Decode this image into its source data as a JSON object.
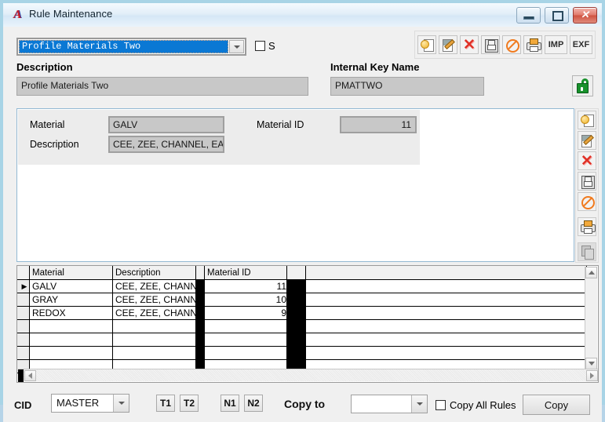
{
  "window": {
    "title": "Rule Maintenance",
    "app_icon": "star-logo-icon",
    "minimize_label": "",
    "maximize_label": "",
    "close_label": "✕"
  },
  "rule_selector": {
    "value": "Profile Materials Two",
    "s_checkbox_label": "S",
    "s_checked": false
  },
  "top_toolbar": {
    "buttons": [
      {
        "name": "new",
        "icon": "new-page-icon",
        "label": ""
      },
      {
        "name": "edit",
        "icon": "edit-pencil-icon",
        "label": ""
      },
      {
        "name": "delete",
        "icon": "delete-x-icon",
        "label": ""
      },
      {
        "name": "save",
        "icon": "save-disk-icon",
        "label": ""
      },
      {
        "name": "cancel",
        "icon": "cancel-ban-icon",
        "label": ""
      },
      {
        "name": "print",
        "icon": "print-icon",
        "label": ""
      },
      {
        "name": "import",
        "icon": "text-icon",
        "label": "IMP"
      },
      {
        "name": "export",
        "icon": "text-icon",
        "label": "EXF"
      }
    ]
  },
  "header_fields": {
    "description_label": "Description",
    "description_value": "Profile Materials Two",
    "internal_key_label": "Internal Key Name",
    "internal_key_value": "PMATTWO",
    "lock_icon": "unlocked-padlock-icon"
  },
  "detail_panel": {
    "material_label": "Material",
    "material_value": "GALV",
    "description_label": "Description",
    "description_value": "CEE, ZEE, CHANNEL, EAʼ",
    "material_id_label": "Material ID",
    "material_id_value": "11"
  },
  "side_toolbar": {
    "buttons": [
      {
        "name": "new",
        "icon": "new-page-icon",
        "disabled": false
      },
      {
        "name": "edit",
        "icon": "edit-pencil-icon",
        "disabled": false
      },
      {
        "name": "delete",
        "icon": "delete-x-icon",
        "disabled": false
      },
      {
        "name": "save",
        "icon": "save-disk-icon",
        "disabled": false
      },
      {
        "name": "cancel",
        "icon": "cancel-ban-icon",
        "disabled": false
      },
      {
        "name": "print",
        "icon": "print-icon",
        "disabled": false
      },
      {
        "name": "copy",
        "icon": "copy-icon",
        "disabled": true
      }
    ]
  },
  "grid": {
    "columns": [
      "Material",
      "Description",
      "Material ID"
    ],
    "rows": [
      {
        "selected": true,
        "material": "GALV",
        "description": "CEE, ZEE, CHANNEL",
        "material_id": "11"
      },
      {
        "selected": false,
        "material": "GRAY",
        "description": "CEE, ZEE, CHANNEL",
        "material_id": "10"
      },
      {
        "selected": false,
        "material": "REDOX",
        "description": "CEE, ZEE, CHANNEL",
        "material_id": "9"
      },
      {
        "selected": false,
        "material": "",
        "description": "",
        "material_id": ""
      },
      {
        "selected": false,
        "material": "",
        "description": "",
        "material_id": ""
      },
      {
        "selected": false,
        "material": "",
        "description": "",
        "material_id": ""
      },
      {
        "selected": false,
        "material": "",
        "description": "",
        "material_id": ""
      }
    ],
    "row_marker": "▶"
  },
  "bottom_bar": {
    "cid_label": "CID",
    "cid_value": "MASTER",
    "t1_label": "T1",
    "t2_label": "T2",
    "n1_label": "N1",
    "n2_label": "N2",
    "copy_to_label": "Copy to",
    "copy_to_value": "",
    "copy_all_rules_label": "Copy All Rules",
    "copy_all_rules_checked": false,
    "copy_button_label": "Copy"
  },
  "colors": {
    "selection_blue": "#0a78d4",
    "window_border": "#a8d4e6",
    "panel_gray": "#f0f0f0",
    "field_gray": "#c8c8c8",
    "lock_green": "#17912b",
    "delete_red": "#e03127"
  }
}
